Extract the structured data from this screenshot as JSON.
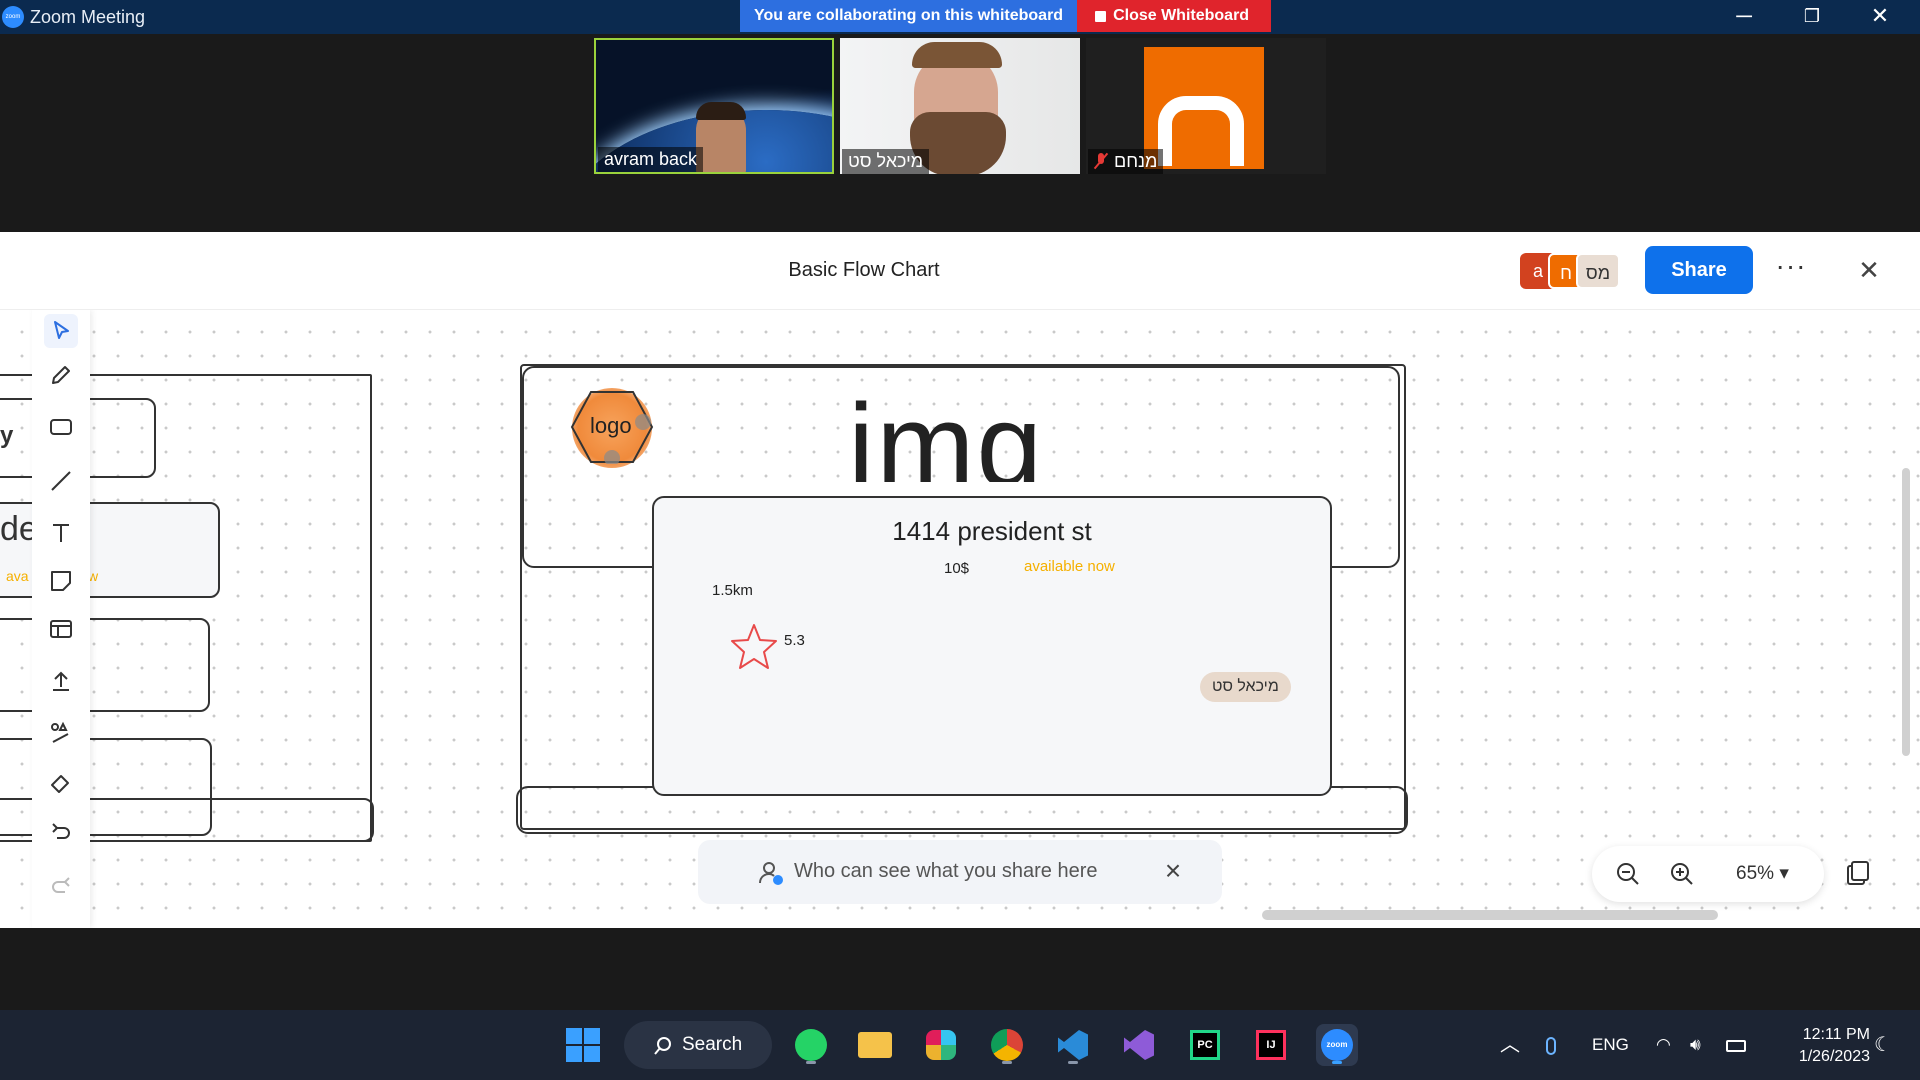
{
  "window": {
    "title": "Zoom Meeting",
    "collab_message": "You are collaborating on this whiteboard",
    "close_whiteboard_label": "Close Whiteboard",
    "minimize": "─",
    "restore": "❐",
    "close": "✕"
  },
  "participants": [
    {
      "name": "avram back"
    },
    {
      "name": "מיכאל סט"
    },
    {
      "name": "מנחם",
      "muted": true
    }
  ],
  "whiteboard": {
    "title": "Basic Flow Chart",
    "avatars": [
      "a",
      "ח",
      "מס"
    ],
    "share_label": "Share",
    "more_label": "···",
    "close_label": "✕"
  },
  "canvas": {
    "left_texts": {
      "y": "y",
      "de": "de",
      "ava": "ava",
      "w": "w"
    },
    "logo_text": "logo",
    "img_text": "img",
    "card": {
      "title": "1414 president st",
      "price": "10$",
      "availability": "available now",
      "distance": "1.5km",
      "rating": "5.3"
    },
    "cursor_label": "מיכאל סט",
    "share_hint": "Who can see what you share here",
    "zoom_level": "65%"
  },
  "taskbar": {
    "search_label": "Search",
    "language": "ENG",
    "time": "12:11 PM",
    "date": "1/26/2023"
  },
  "colors": {
    "accent": "#0e71eb",
    "close_whiteboard": "#e0242c",
    "available": "#f5b000",
    "star": "#e84a4a"
  }
}
